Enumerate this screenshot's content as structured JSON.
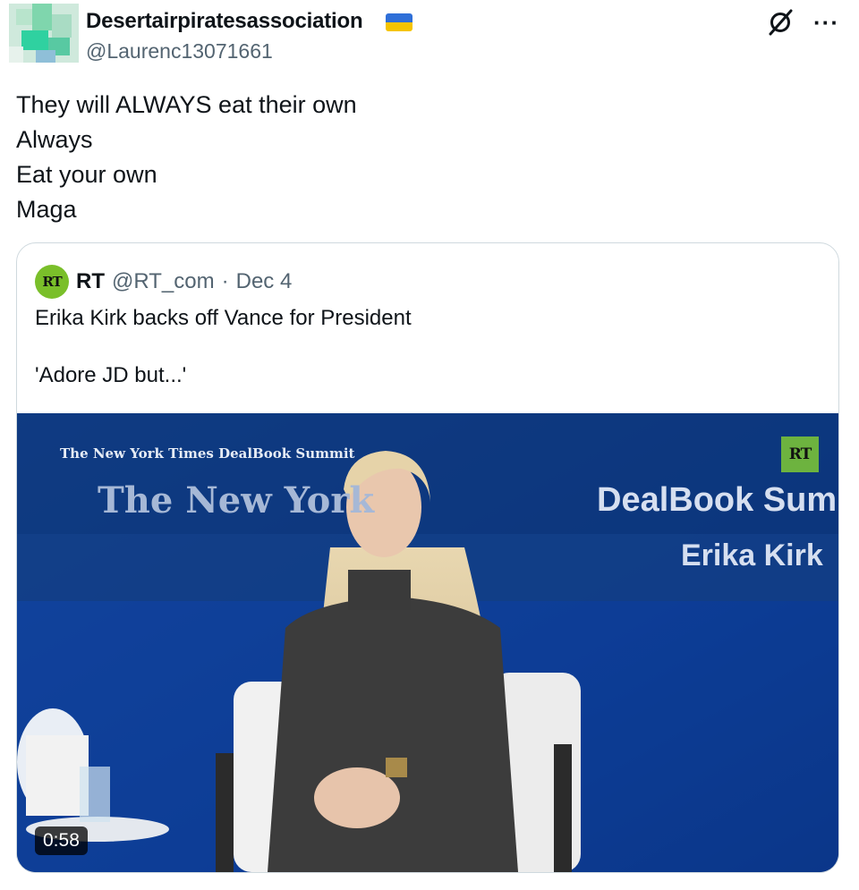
{
  "tweet": {
    "author_name": "Desertairpiratesassociation",
    "author_handle": "@Laurenc13071661",
    "flag_icon": "ukraine-flag-icon",
    "text_lines": [
      "They will ALWAYS eat their own",
      "Always",
      "Eat your own",
      "Maga"
    ]
  },
  "quoted": {
    "avatar_text": "RT",
    "author_name": "RT",
    "author_handle": "@RT_com",
    "separator": "·",
    "date": "Dec 4",
    "text_lines": [
      "Erika Kirk backs off Vance for President",
      "",
      "'Adore JD but...'"
    ]
  },
  "video": {
    "small_banner": "The New York Times DealBook Summit",
    "big_banner": "The New York",
    "dealbook_text": "DealBook Sum",
    "speaker_name": "Erika Kirk",
    "logo_text": "RT",
    "duration": "0:58"
  },
  "colors": {
    "accent": "#1d9bf0",
    "rt_green": "#7abf2a",
    "muted": "#536471",
    "video_bg": "#0b2a66"
  },
  "icons": {
    "grok": "grok-icon",
    "more": "more-options-icon"
  }
}
